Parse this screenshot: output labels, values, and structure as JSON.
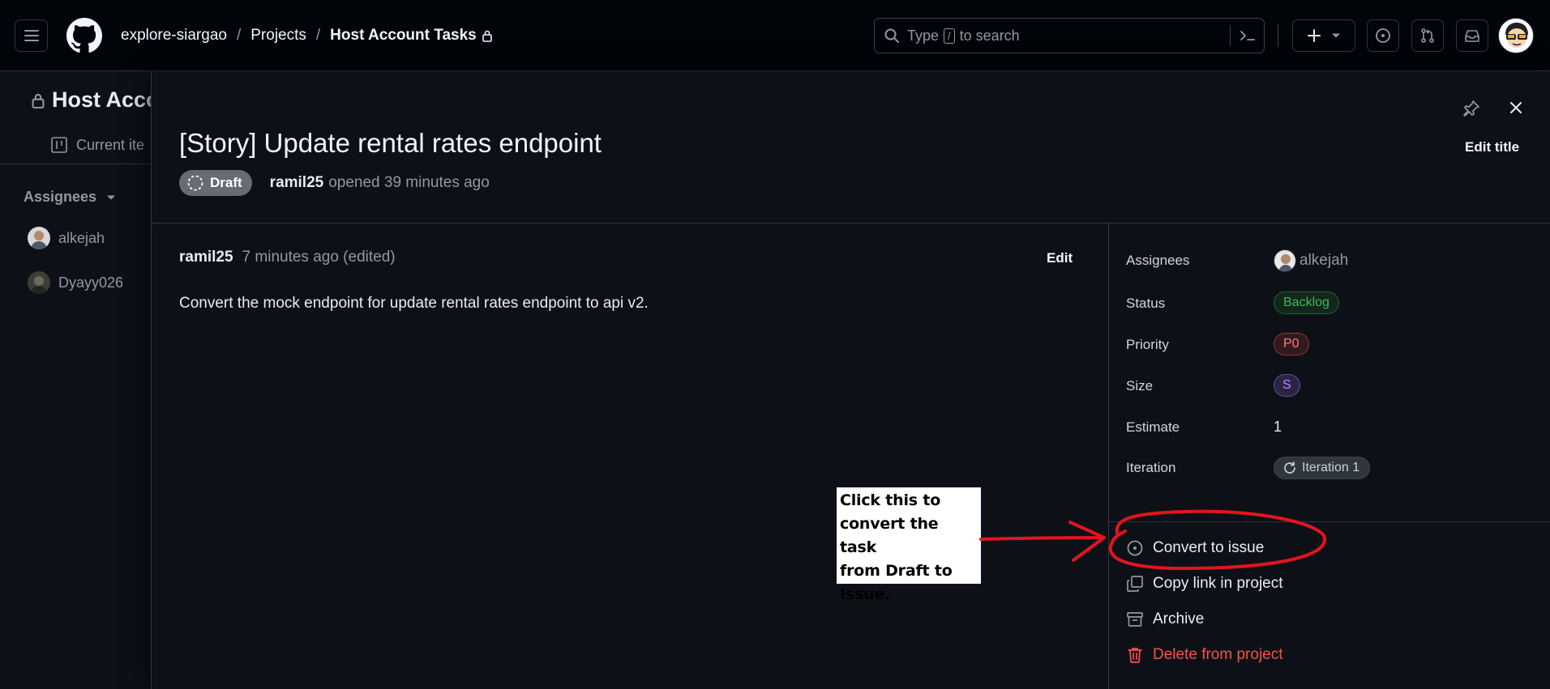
{
  "header": {
    "breadcrumb": {
      "org": "explore-siargao",
      "projects": "Projects",
      "project": "Host Account Tasks",
      "sep": "/"
    },
    "search": {
      "prefix": "Type",
      "key": "/",
      "suffix": "to search"
    },
    "icons": [
      "hamburger-icon",
      "github-logo-icon",
      "search-icon",
      "command-palette-icon",
      "plus-icon",
      "chevron-down-icon",
      "issues-icon",
      "pull-requests-icon",
      "inbox-icon"
    ]
  },
  "background": {
    "project_title": "Host Acco",
    "tab_label": "Current ite",
    "group_label": "Assignees",
    "people": [
      "alkejah",
      "Dyayy026"
    ]
  },
  "panel": {
    "title": "[Story] Update rental rates endpoint",
    "edit_title_label": "Edit title",
    "status_badge": "Draft",
    "opened_by": "ramil25",
    "opened_text": "opened 39 minutes ago",
    "comment": {
      "author": "ramil25",
      "time": "7 minutes ago (edited)",
      "edit_label": "Edit",
      "body": "Convert the mock endpoint for update rental rates endpoint to api v2."
    },
    "fields": {
      "assignees": {
        "label": "Assignees",
        "value": "alkejah"
      },
      "status": {
        "label": "Status",
        "value": "Backlog",
        "color": "#3fb950"
      },
      "priority": {
        "label": "Priority",
        "value": "P0",
        "color": "#ff7b72"
      },
      "size": {
        "label": "Size",
        "value": "S",
        "color": "#bc8cff"
      },
      "estimate": {
        "label": "Estimate",
        "value": "1"
      },
      "iteration": {
        "label": "Iteration",
        "value": "Iteration 1"
      }
    },
    "actions": {
      "convert": "Convert to issue",
      "copy_link": "Copy link in project",
      "archive": "Archive",
      "delete": "Delete from project"
    }
  },
  "annotation": {
    "lines": [
      "Click this to",
      "convert the task",
      "from Draft to",
      "Issue."
    ],
    "color": "#e3141d"
  }
}
